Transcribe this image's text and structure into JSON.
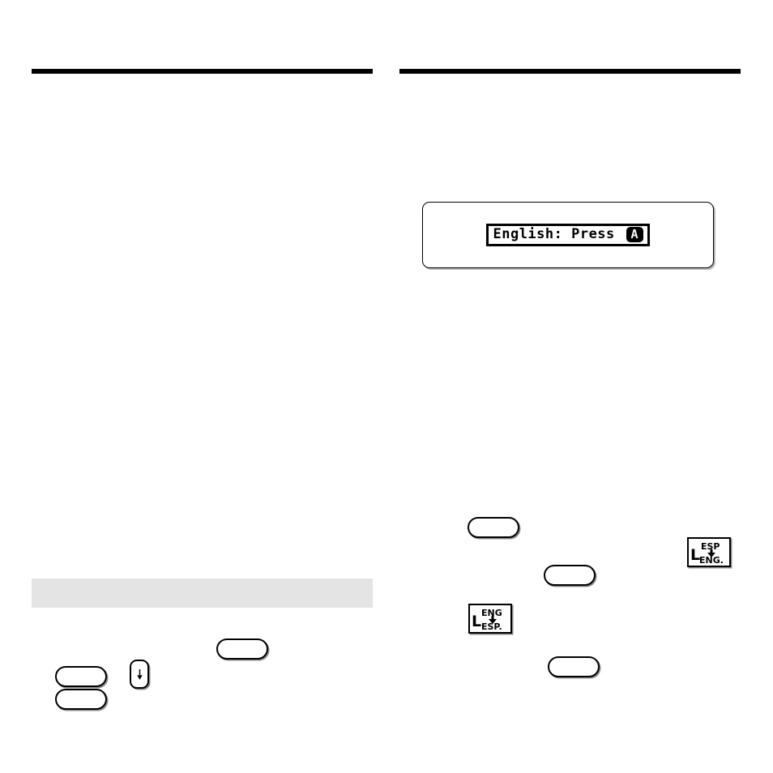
{
  "page": {
    "background_color": "#ffffff",
    "layout": "two-column",
    "rule_color": "#000000"
  },
  "columns": {
    "left": {
      "name": "left-column"
    },
    "right": {
      "name": "right-column"
    }
  },
  "lcd_display": {
    "message": "English: Press ",
    "key_glyph_letter": "A",
    "full_text": "English: Press (A)"
  },
  "highlight_bar": {
    "color": "#e4e4e4"
  },
  "keys": {
    "left": [
      {
        "name": "key-left-a",
        "label": ""
      },
      {
        "name": "key-left-b",
        "label": ""
      },
      {
        "name": "key-left-c",
        "label": ""
      }
    ],
    "right": [
      {
        "name": "key-right-a",
        "label": ""
      },
      {
        "name": "key-right-b",
        "label": ""
      },
      {
        "name": "key-right-c",
        "label": ""
      }
    ],
    "arrow_key": {
      "name": "down-arrow-key",
      "glyph": "↓"
    }
  },
  "language_icons": [
    {
      "name": "esp-to-eng-icon",
      "from": "ESP",
      "to": "ENG.",
      "direction": "down"
    },
    {
      "name": "eng-to-esp-icon",
      "from": "ENG",
      "to": "ESP.",
      "direction": "down"
    }
  ]
}
